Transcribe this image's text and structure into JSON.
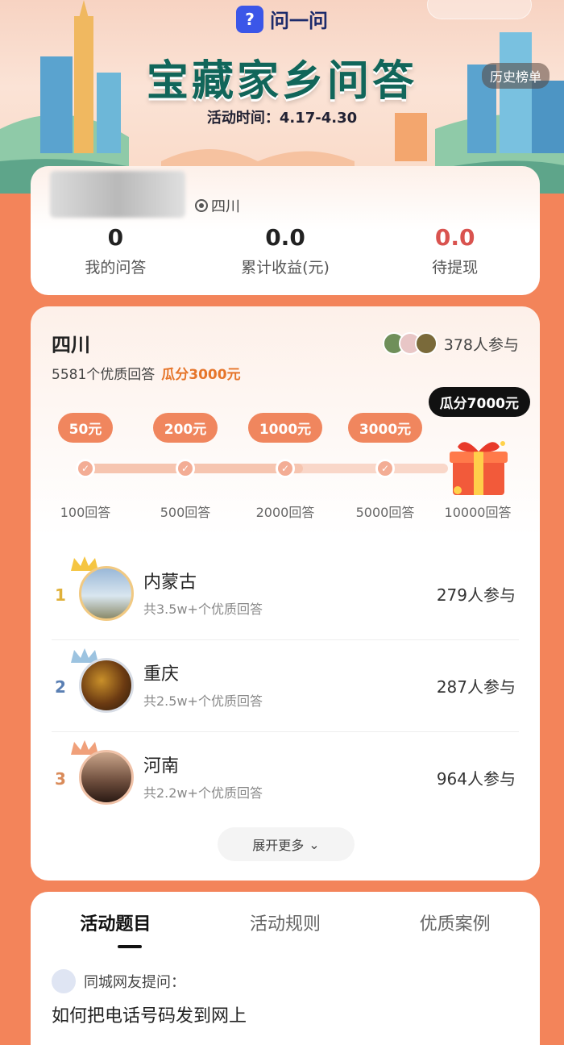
{
  "header": {
    "brand_name": "问一问",
    "brand_logo_icon": "question-logo-icon",
    "title": "宝藏家乡问答",
    "period": "活动时间：4.17-4.30",
    "history_label": "历史榜单"
  },
  "user": {
    "location": "四川",
    "stats": [
      {
        "value": "0",
        "label": "我的问答"
      },
      {
        "value": "0.0",
        "label": "累计收益(元)"
      },
      {
        "value": "0.0",
        "label": "待提现"
      }
    ]
  },
  "province": {
    "name": "四川",
    "subtitle": "5581个优质回答",
    "highlight": "瓜分3000元",
    "participants": "378人参与",
    "progress_fraction": 0.6,
    "milestones": [
      {
        "reward": "50元",
        "label": "100回答"
      },
      {
        "reward": "200元",
        "label": "500回答"
      },
      {
        "reward": "1000元",
        "label": "2000回答"
      },
      {
        "reward": "3000元",
        "label": "5000回答"
      }
    ],
    "final_reward": "瓜分7000元",
    "final_label": "10000回答"
  },
  "ranking": [
    {
      "rank": "1",
      "name": "内蒙古",
      "sub": "共3.5w+个优质回答",
      "count": "279人参与",
      "color": "#e0b13a"
    },
    {
      "rank": "2",
      "name": "重庆",
      "sub": "共2.5w+个优质回答",
      "count": "287人参与",
      "color": "#5a7fb3"
    },
    {
      "rank": "3",
      "name": "河南",
      "sub": "共2.2w+个优质回答",
      "count": "964人参与",
      "color": "#d98b5a"
    }
  ],
  "expand_label": "展开更多",
  "tabs": [
    "活动题目",
    "活动规则",
    "优质案例"
  ],
  "question": {
    "header": "同城网友提问：",
    "text": "如何把电话号码发到网上"
  }
}
